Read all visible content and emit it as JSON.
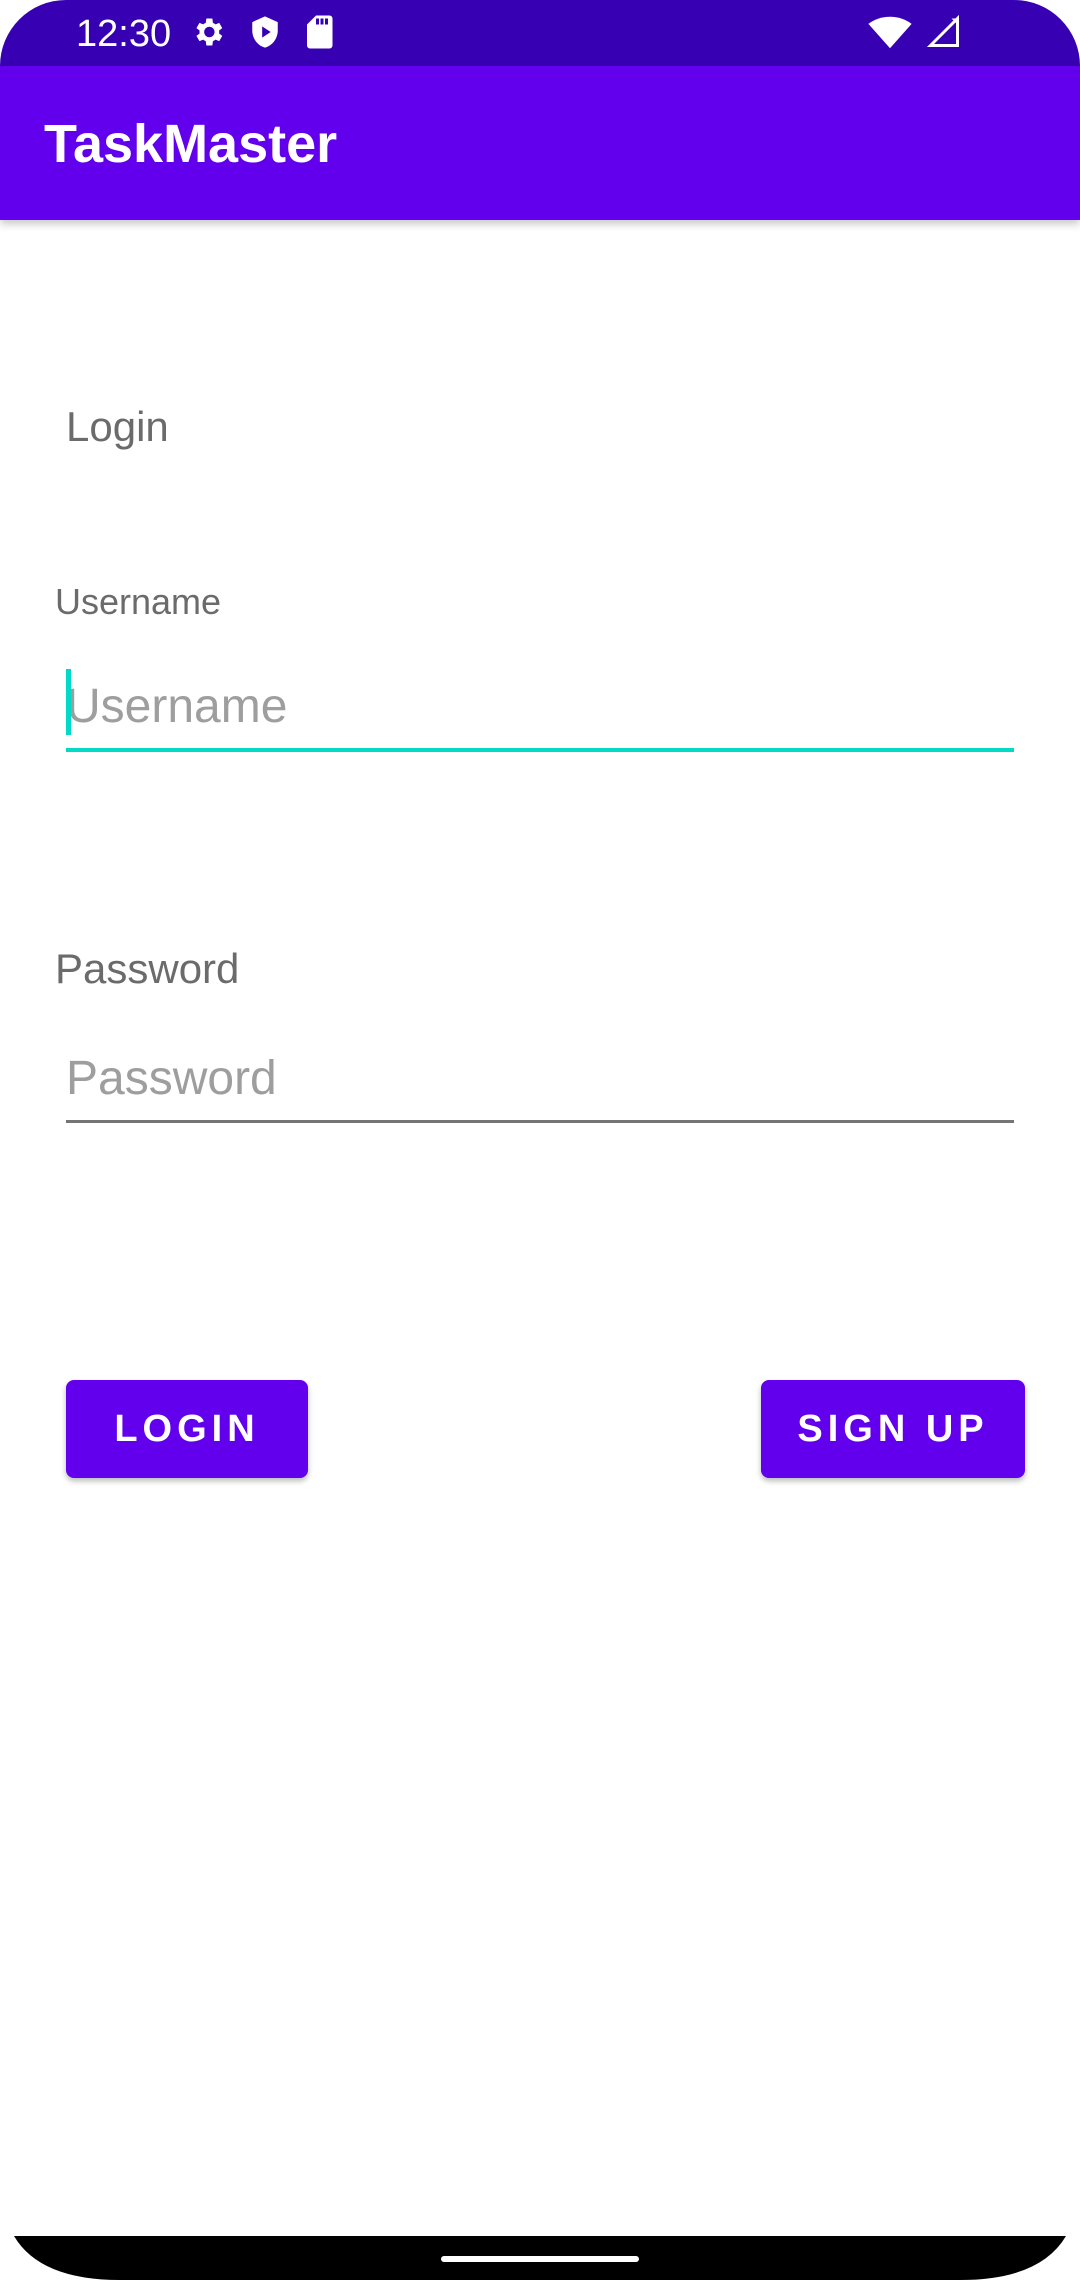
{
  "status_bar": {
    "time": "12:30",
    "icons_left": [
      "gear-icon",
      "play-protect-icon",
      "sd-card-icon"
    ],
    "icons_right": [
      "wifi-icon",
      "cellular-signal-icon"
    ]
  },
  "app_bar": {
    "title": "TaskMaster"
  },
  "login_form": {
    "heading": "Login",
    "username_label": "Username",
    "username_placeholder": "Username",
    "username_value": "",
    "password_label": "Password",
    "password_placeholder": "Password",
    "password_value": ""
  },
  "actions": {
    "login_label": "LOGIN",
    "signup_label": "SIGN UP"
  },
  "colors": {
    "primary": "#6200ee",
    "primary_dark": "#3700b3",
    "accent": "#03dac5"
  }
}
